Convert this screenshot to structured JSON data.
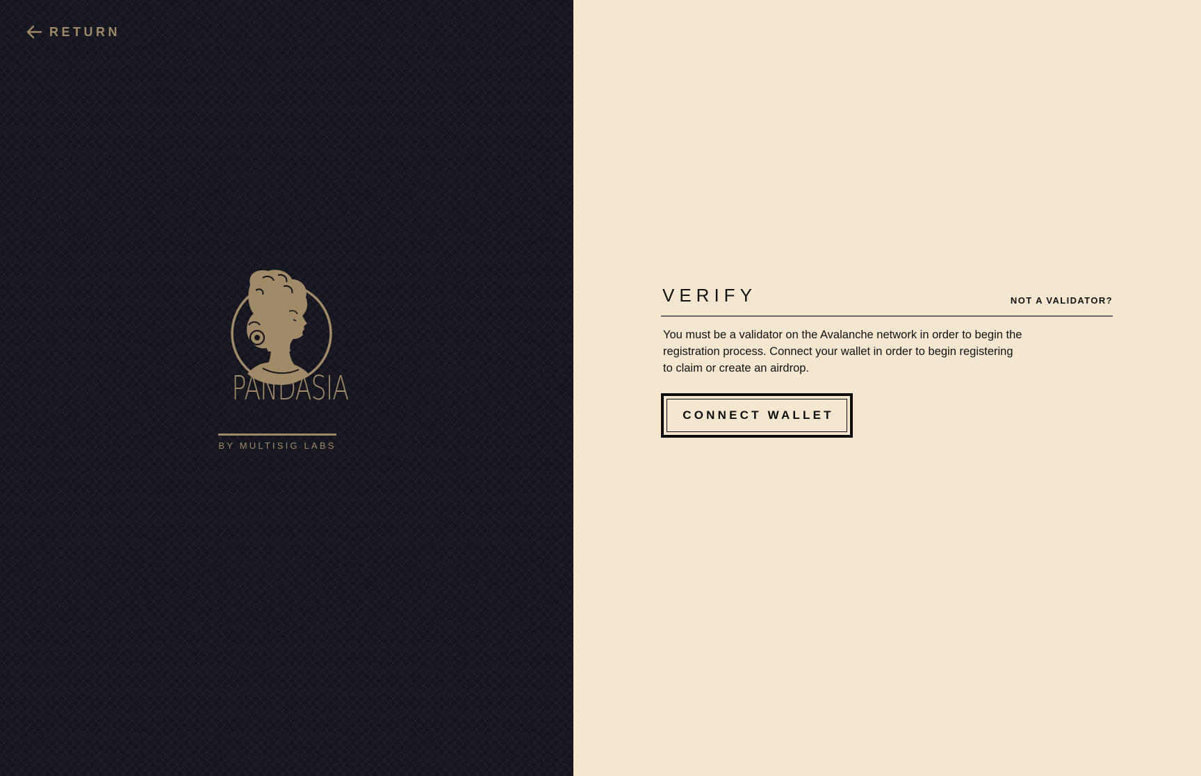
{
  "nav": {
    "return_label": "RETURN",
    "return_icon": "arrow-left-icon"
  },
  "brand": {
    "name": "PANDASIA",
    "subtitle": "BY MULTISIG LABS",
    "emblem_icon": "goddess-portrait-emblem",
    "color": "#a08a68"
  },
  "verify": {
    "title": "VERIFY",
    "not_validator_link": "NOT A VALIDATOR?",
    "description": "You must be a validator on the Avalanche network in order to begin the registration process. Connect your wallet in order to begin registering to claim or create an airdrop.",
    "connect_button_label": "CONNECT WALLET"
  },
  "colors": {
    "left_bg": "#14151f",
    "right_bg": "#f5e6d0",
    "gold": "#a08a68",
    "text": "#111111"
  }
}
